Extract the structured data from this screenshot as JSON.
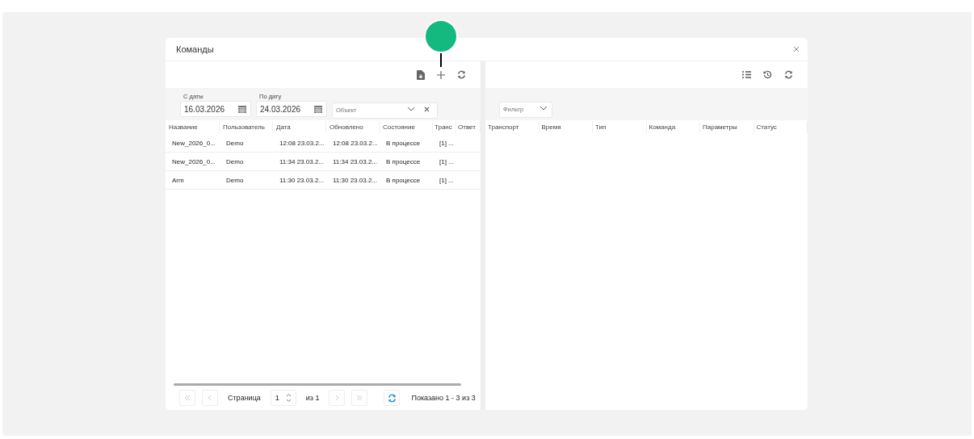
{
  "dialog": {
    "title": "Команды"
  },
  "left": {
    "toolbar": [
      {
        "kind": "download"
      },
      {
        "kind": "add",
        "marked": true
      },
      {
        "kind": "refresh"
      }
    ],
    "filters": {
      "from": {
        "label": "С даты",
        "value": "16.03.2026"
      },
      "to": {
        "label": "По дату",
        "value": "24.03.2026"
      },
      "object": {
        "placeholder": "Объект"
      }
    },
    "table": {
      "columns": [
        "Название",
        "Пользователь",
        "Дата",
        "Обновлено",
        "Состояние",
        "Транс",
        "Ответ"
      ],
      "rows": [
        [
          "New_2026_0...",
          "Demo",
          "12:08 23.03.2...",
          "12:08 23.03.2...",
          "В процессе",
          "[1] ...",
          ""
        ],
        [
          "New_2026_0...",
          "Demo",
          "11:34 23.03.2...",
          "11:34 23.03.2...",
          "В процессе",
          "[1] ...",
          ""
        ],
        [
          "Arm",
          "Demo",
          "11:30 23.03.2...",
          "11:30 23.03.2...",
          "В процессе",
          "[1] ...",
          ""
        ]
      ]
    },
    "pager": {
      "first": {
        "disabled": true
      },
      "prev": {
        "disabled": true
      },
      "page_label": "Страница",
      "page": "1",
      "of": "из 1",
      "next": {
        "disabled": true
      },
      "last": {
        "disabled": true
      },
      "summary": "Показано 1 - 3 из 3"
    }
  },
  "right": {
    "toolbar": [
      {
        "kind": "list"
      },
      {
        "kind": "history"
      },
      {
        "kind": "refresh"
      }
    ],
    "filter": {
      "placeholder": "Фильтр"
    },
    "table": {
      "columns": [
        "Транспорт",
        "Время",
        "Тип",
        "Команда",
        "Параметры",
        "Статус"
      ]
    }
  }
}
